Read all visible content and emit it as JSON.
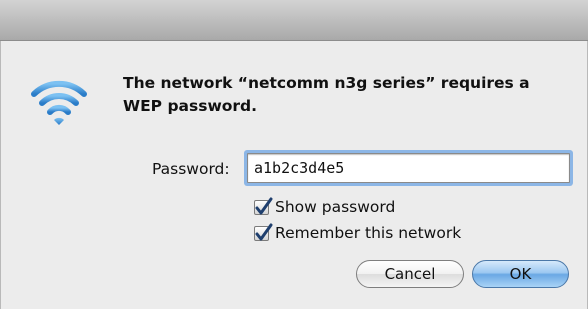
{
  "dialog": {
    "message": "The network “netcomm n3g series” requires a WEP password.",
    "password_label": "Password:",
    "password_value": "a1b2c3d4e5",
    "show_password": {
      "label": "Show password",
      "checked": true
    },
    "remember_network": {
      "label": "Remember this network",
      "checked": true
    },
    "cancel_label": "Cancel",
    "ok_label": "OK"
  },
  "icon": {
    "name": "wifi-icon",
    "color": "#3d8fd6"
  }
}
